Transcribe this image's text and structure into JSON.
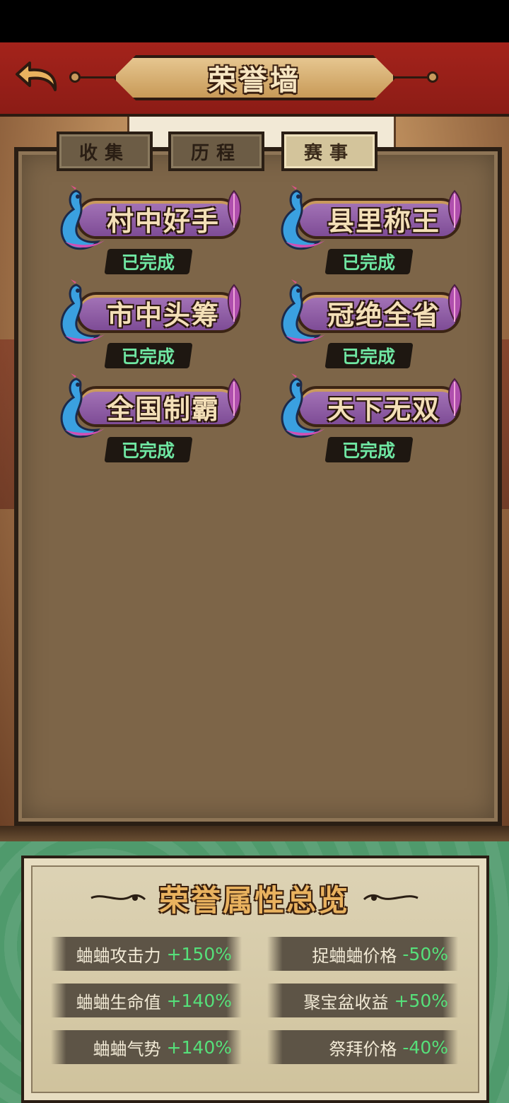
{
  "header": {
    "title": "荣誉墙"
  },
  "tabs": [
    {
      "label": "收集",
      "active": false
    },
    {
      "label": "历程",
      "active": false
    },
    {
      "label": "赛事",
      "active": true
    }
  ],
  "achievements": [
    {
      "title": "村中好手",
      "status": "已完成"
    },
    {
      "title": "县里称王",
      "status": "已完成"
    },
    {
      "title": "市中头筹",
      "status": "已完成"
    },
    {
      "title": "冠绝全省",
      "status": "已完成"
    },
    {
      "title": "全国制霸",
      "status": "已完成"
    },
    {
      "title": "天下无双",
      "status": "已完成"
    }
  ],
  "attributes": {
    "title": "荣誉属性总览",
    "stats": [
      {
        "label": "蛐蛐攻击力",
        "value": "+150%"
      },
      {
        "label": "捉蛐蛐价格",
        "value": "-50%"
      },
      {
        "label": "蛐蛐生命值",
        "value": "+140%"
      },
      {
        "label": "聚宝盆收益",
        "value": "+50%"
      },
      {
        "label": "蛐蛐气势",
        "value": "+140%"
      },
      {
        "label": "祭拜价格",
        "value": "-40%"
      }
    ]
  },
  "colors": {
    "header_red": "#a4231b",
    "status_green": "#6fe6a2",
    "stat_value_green": "#56e07a",
    "banner_purple": "#8e5aa8"
  },
  "icons": [
    "back-arrow-icon",
    "peacock-icon",
    "feather-icon",
    "flourish-icon"
  ]
}
